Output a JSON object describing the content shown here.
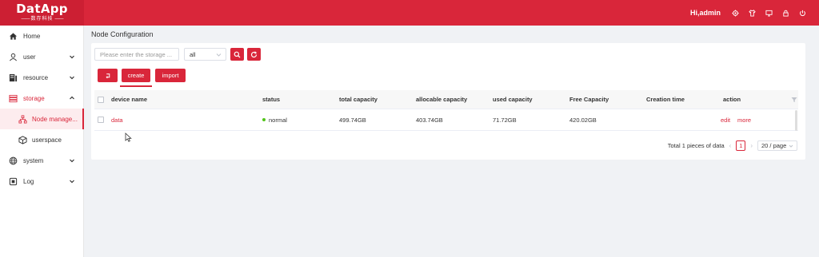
{
  "app": {
    "logo_text": "DatApp",
    "logo_subtitle": "数存科技",
    "greeting": "Hi,admin",
    "header_icons": [
      "gear-icon",
      "shirt-icon",
      "monitor-icon",
      "lock-icon",
      "power-icon"
    ],
    "accent_color": "#d9263a"
  },
  "sidebar": {
    "items": [
      {
        "label": "Home",
        "icon": "home-icon"
      },
      {
        "label": "user",
        "icon": "user-icon"
      },
      {
        "label": "resource",
        "icon": "server-icon"
      },
      {
        "label": "storage",
        "icon": "storage-icon"
      },
      {
        "label": "system",
        "icon": "globe-icon"
      },
      {
        "label": "Log",
        "icon": "log-icon"
      }
    ],
    "storage_children": [
      {
        "label": "Node manage...",
        "icon": "nodes-icon"
      },
      {
        "label": "userspace",
        "icon": "box-icon"
      }
    ]
  },
  "page": {
    "title": "Node Configuration"
  },
  "filters": {
    "search_placeholder": "Please enter the storage ...",
    "select_value": "all"
  },
  "actions": {
    "create_label": "create",
    "import_label": "import"
  },
  "table": {
    "headers": [
      "device name",
      "status",
      "total capacity",
      "allocable capacity",
      "used capacity",
      "Free Capacity",
      "Creation time",
      "action"
    ],
    "rows": [
      {
        "device_name": "data",
        "status": "normal",
        "total_capacity": "499.74GB",
        "allocable_capacity": "403.74GB",
        "used_capacity": "71.72GB",
        "free_capacity": "420.02GB",
        "creation_time": "",
        "edit_label": "edit",
        "more_label": "more"
      }
    ]
  },
  "pagination": {
    "total_text": "Total 1 pieces of data",
    "current_page": "1",
    "page_size": "20 / page"
  }
}
